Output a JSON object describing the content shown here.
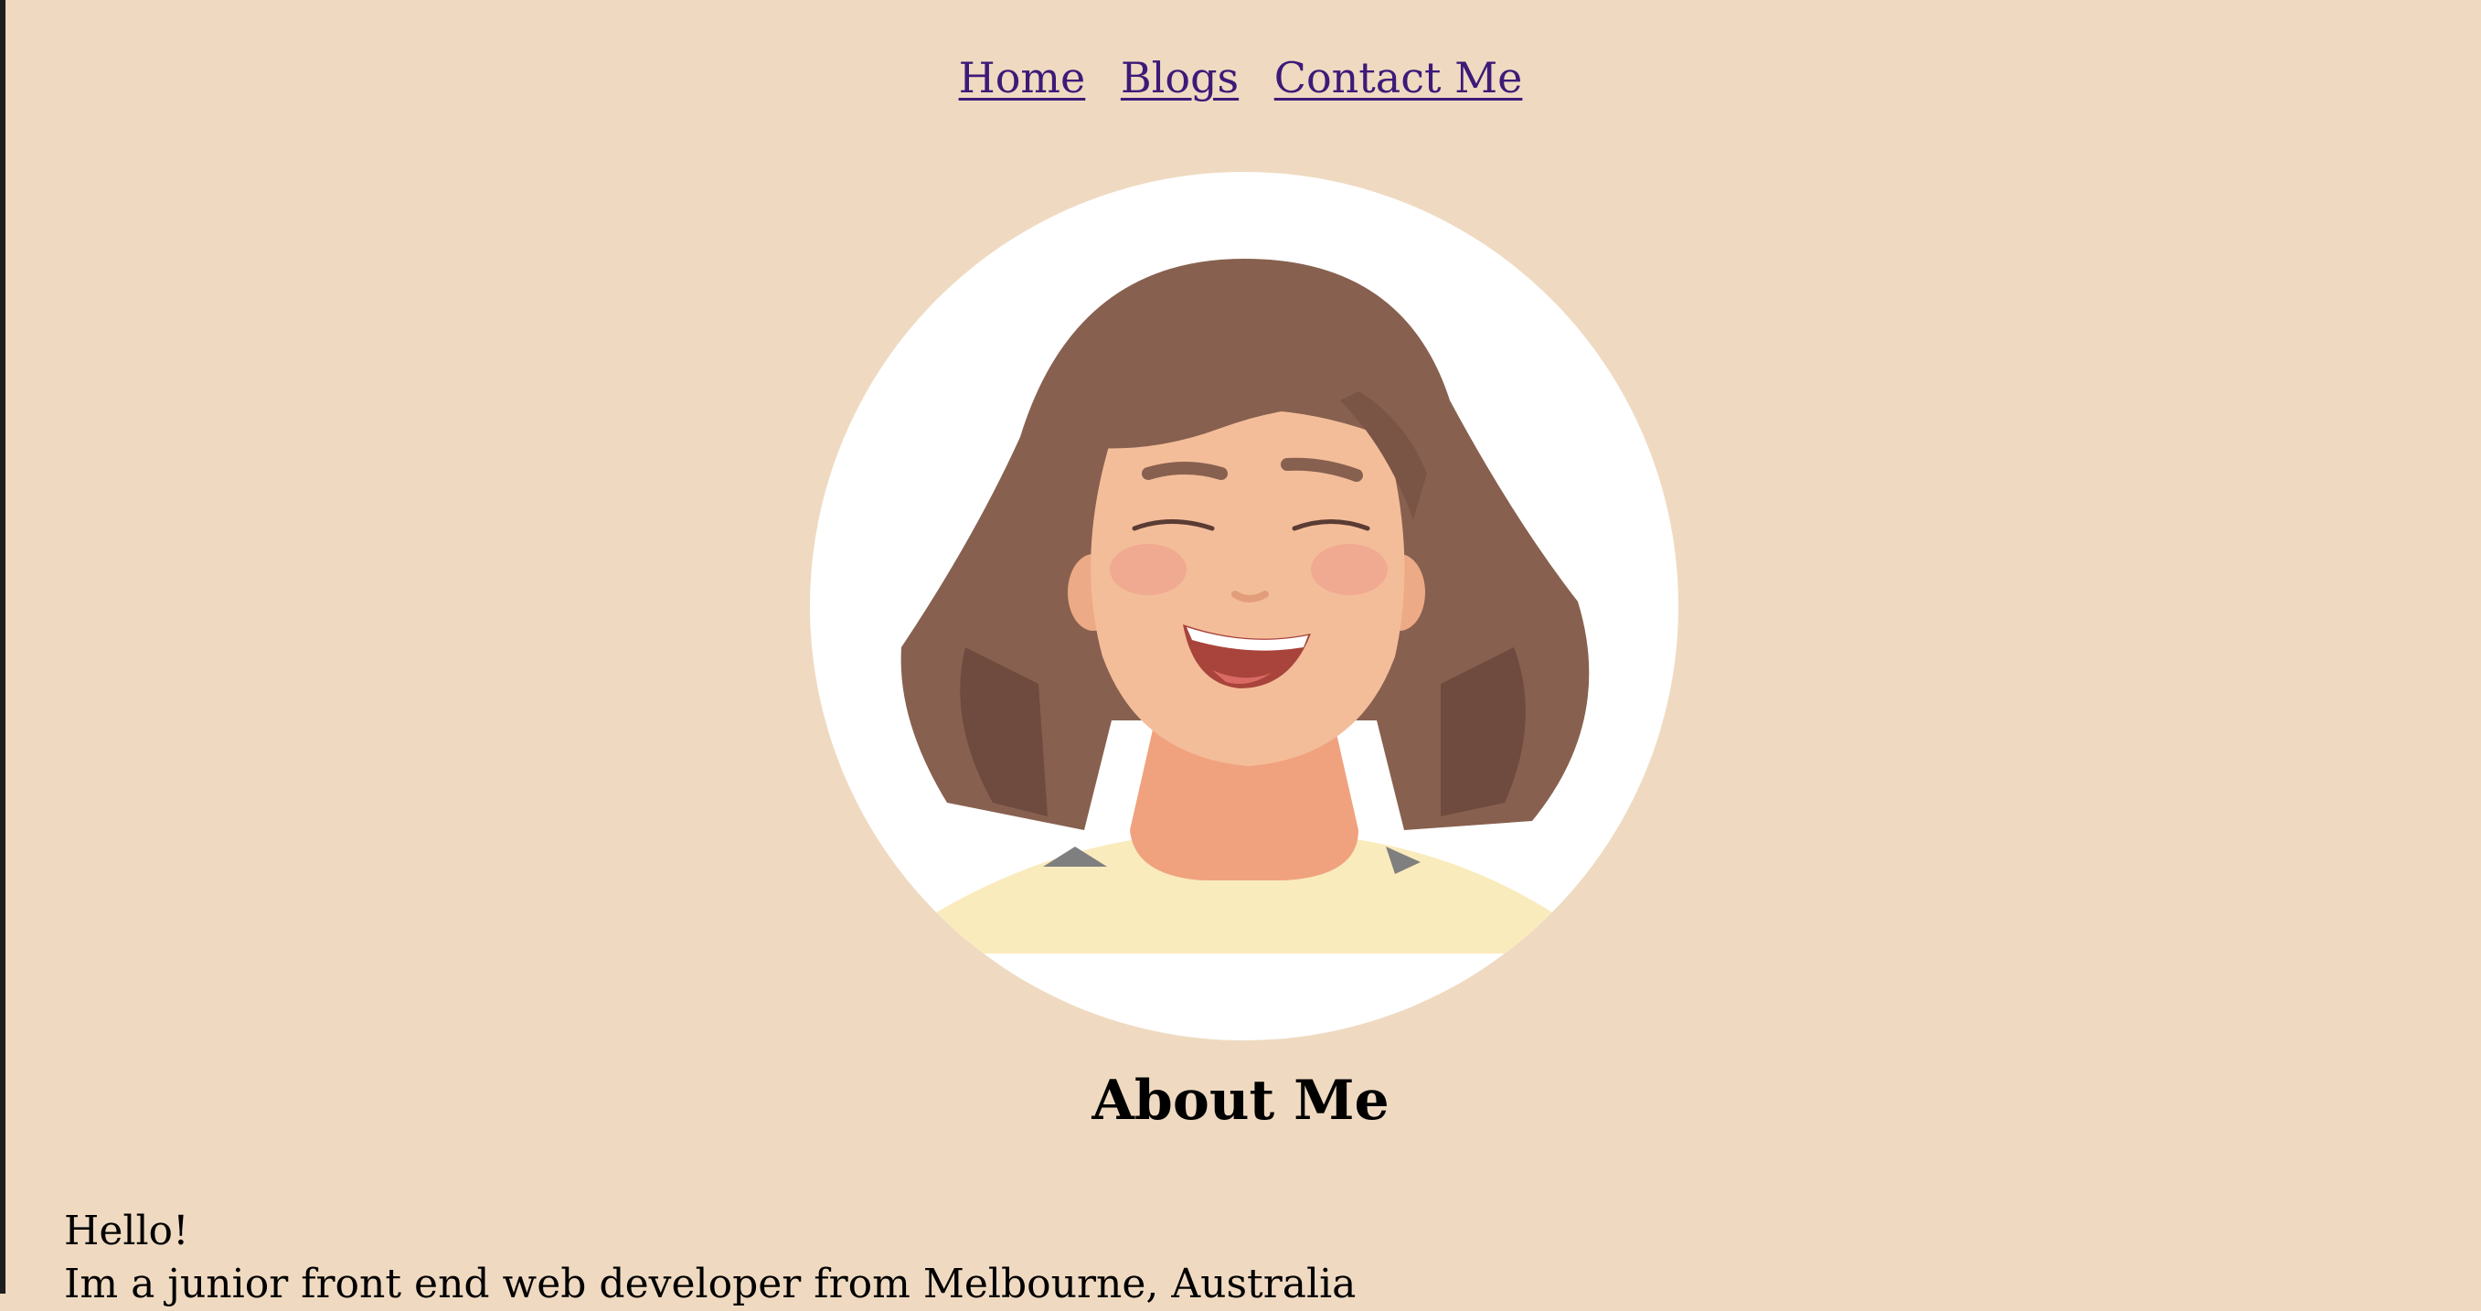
{
  "nav": {
    "items": [
      {
        "label": "Home"
      },
      {
        "label": "Blogs"
      },
      {
        "label": "Contact Me"
      }
    ]
  },
  "profile": {
    "avatar_icon": "smiling-woman-avatar-illustration"
  },
  "main": {
    "title": "About Me",
    "greeting": "Hello!",
    "intro_line": "Im a junior front end web developer from Melbourne, Australia"
  },
  "colors": {
    "background": "#efdac1",
    "link": "#3d1a78",
    "text": "#000000",
    "avatar_background": "#ffffff",
    "hair": "#87604f",
    "skin": "#f0b896",
    "shirt": "#faebbd"
  }
}
